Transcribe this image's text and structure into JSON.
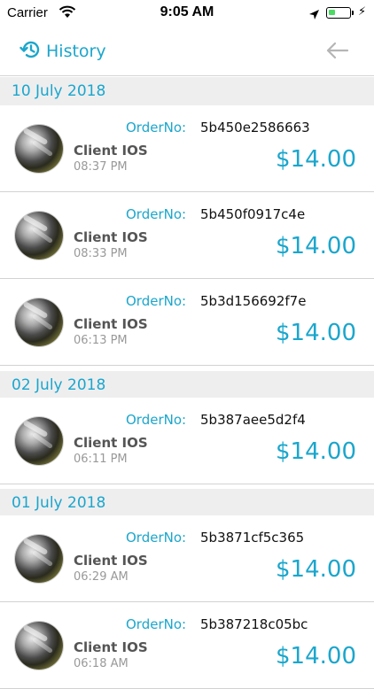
{
  "status_bar": {
    "carrier": "Carrier",
    "time": "9:05 AM",
    "battery_level": 0.35
  },
  "nav": {
    "title": "History"
  },
  "sections": [
    {
      "date": "10 July 2018",
      "orders": [
        {
          "order_label": "OrderNo:",
          "order_no": "5b450e2586663",
          "client": "Client IOS",
          "time": "08:37 PM",
          "amount": "$14.00"
        },
        {
          "order_label": "OrderNo:",
          "order_no": "5b450f0917c4e",
          "client": "Client IOS",
          "time": "08:33 PM",
          "amount": "$14.00"
        },
        {
          "order_label": "OrderNo:",
          "order_no": "5b3d156692f7e",
          "client": "Client IOS",
          "time": "06:13 PM",
          "amount": "$14.00"
        }
      ]
    },
    {
      "date": "02 July 2018",
      "orders": [
        {
          "order_label": "OrderNo:",
          "order_no": "5b387aee5d2f4",
          "client": "Client IOS",
          "time": "06:11 PM",
          "amount": "$14.00"
        }
      ]
    },
    {
      "date": "01 July 2018",
      "orders": [
        {
          "order_label": "OrderNo:",
          "order_no": "5b3871cf5c365",
          "client": "Client IOS",
          "time": "06:29 AM",
          "amount": "$14.00"
        },
        {
          "order_label": "OrderNo:",
          "order_no": "5b387218c05bc",
          "client": "Client IOS",
          "time": "06:18 AM",
          "amount": "$14.00"
        }
      ]
    }
  ]
}
